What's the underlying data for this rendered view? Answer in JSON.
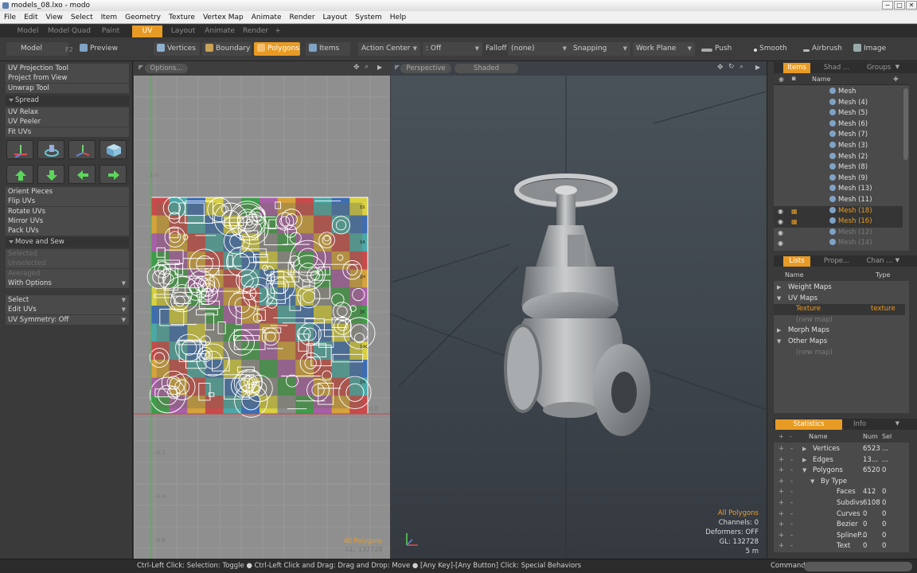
{
  "window": {
    "title": "models_08.lxo - modo",
    "min": "−",
    "max": "□",
    "close": "✕"
  },
  "menu": [
    "File",
    "Edit",
    "View",
    "Select",
    "Item",
    "Geometry",
    "Texture",
    "Vertex Map",
    "Animate",
    "Render",
    "Layout",
    "System",
    "Help"
  ],
  "layout_tabs": [
    "Model",
    "Model Quad",
    "Paint",
    "UV",
    "Layout",
    "Animate",
    "Render",
    "+"
  ],
  "active_layout_tab": "UV",
  "toolbar": {
    "model": "Model",
    "f2": "F2",
    "preview": "Preview",
    "vertices": "Vertices",
    "boundary": "Boundary",
    "polygons": "Polygons",
    "items": "Items",
    "action_center": "Action Center",
    "action_center_value": ": Off",
    "falloff": "Falloff",
    "falloff_value": "(none)",
    "snapping": "Snapping",
    "work_plane": "Work Plane",
    "push": "Push",
    "smooth": "Smooth",
    "airbrush": "Airbrush",
    "image": "Image"
  },
  "left_tools": {
    "group1": [
      "UV Projection Tool",
      "Project from View",
      "Unwrap Tool"
    ],
    "spread_header": "Spread",
    "group2": [
      "UV Relax",
      "UV Peeler",
      "Fit UVs"
    ],
    "group3": [
      "Orient Pieces",
      "Flip UVs",
      "Rotate UVs",
      "Mirror UVs",
      "Pack UVs"
    ],
    "move_sew_header": "Move and Sew",
    "group4_dim": [
      "Selected",
      "Unselected",
      "Averaged"
    ],
    "with_options": "With Options",
    "dropdowns": [
      "Select",
      "Edit UVs",
      "UV Symmetry: Off"
    ]
  },
  "uv_view": {
    "options": "Options...",
    "tick_top": "1.0",
    "tick_zero": "0.0",
    "ticks_left": [
      "-0.2",
      "-0.4",
      "-0.6"
    ],
    "footer_label": "All Polygons",
    "footer_gl": "GL: 132728",
    "checker_tags": [
      "1S",
      "14",
      "1H",
      "1K",
      "14K",
      "1N"
    ]
  },
  "viewport": {
    "camera": "Perspective",
    "shading": "Shaded",
    "info_title": "All Polygons",
    "channels": "Channels: 0",
    "deformers": "Deformers: OFF",
    "gl": "GL: 132728",
    "scale": "5 m"
  },
  "items_panel": {
    "tabs": [
      "Items",
      "Shad ...",
      "Groups"
    ],
    "col_name": "Name",
    "items": [
      {
        "name": "Mesh",
        "state": "normal"
      },
      {
        "name": "Mesh (4)",
        "state": "normal"
      },
      {
        "name": "Mesh (5)",
        "state": "normal"
      },
      {
        "name": "Mesh (6)",
        "state": "normal"
      },
      {
        "name": "Mesh (7)",
        "state": "normal"
      },
      {
        "name": "Mesh (3)",
        "state": "normal"
      },
      {
        "name": "Mesh (2)",
        "state": "normal"
      },
      {
        "name": "Mesh (8)",
        "state": "normal"
      },
      {
        "name": "Mesh (9)",
        "state": "normal"
      },
      {
        "name": "Mesh (13)",
        "state": "normal"
      },
      {
        "name": "Mesh (11)",
        "state": "normal"
      },
      {
        "name": "Mesh (18)",
        "state": "selected"
      },
      {
        "name": "Mesh (16)",
        "state": "selected"
      },
      {
        "name": "Mesh (12)",
        "state": "dim"
      },
      {
        "name": "Mesh (14)",
        "state": "dim"
      }
    ]
  },
  "lists_panel": {
    "tabs": [
      "Lists",
      "Prope...",
      "Chan ..."
    ],
    "col_name": "Name",
    "col_type": "Type",
    "rows": [
      {
        "label": "Weight Maps",
        "type": "",
        "kind": "group-closed"
      },
      {
        "label": "UV Maps",
        "type": "",
        "kind": "group-open"
      },
      {
        "label": "Texture",
        "type": "texture",
        "kind": "selected"
      },
      {
        "label": "(new map)",
        "type": "",
        "kind": "dim"
      },
      {
        "label": "Morph Maps",
        "type": "",
        "kind": "group-closed"
      },
      {
        "label": "Other Maps",
        "type": "",
        "kind": "group-open"
      },
      {
        "label": "(new map)",
        "type": "",
        "kind": "dim"
      }
    ]
  },
  "stats_panel": {
    "tabs": [
      "Statistics",
      "Info"
    ],
    "headers": [
      "Name",
      "Num",
      "Sel"
    ],
    "rows": [
      {
        "name": "Vertices",
        "num": "6523",
        "sel": "...",
        "indent": 1,
        "arrow": "▶"
      },
      {
        "name": "Edges",
        "num": "13...",
        "sel": "...",
        "indent": 1,
        "arrow": "▶"
      },
      {
        "name": "Polygons",
        "num": "6520",
        "sel": "0",
        "indent": 1,
        "arrow": "▼"
      },
      {
        "name": "By Type",
        "num": "",
        "sel": "",
        "indent": 2,
        "arrow": "▼"
      },
      {
        "name": "Faces",
        "num": "412",
        "sel": "0",
        "indent": 3,
        "arrow": ""
      },
      {
        "name": "Subdivs",
        "num": "6108",
        "sel": "0",
        "indent": 3,
        "arrow": ""
      },
      {
        "name": "Curves",
        "num": "0",
        "sel": "0",
        "indent": 3,
        "arrow": ""
      },
      {
        "name": "Bezier",
        "num": "0",
        "sel": "0",
        "indent": 3,
        "arrow": ""
      },
      {
        "name": "SplineP...",
        "num": "0",
        "sel": "0",
        "indent": 3,
        "arrow": ""
      },
      {
        "name": "Text",
        "num": "0",
        "sel": "0",
        "indent": 3,
        "arrow": ""
      }
    ]
  },
  "statusbar": {
    "hint": "Ctrl-Left Click: Selection: Toggle ● Ctrl-Left Click and Drag: Drag and Drop: Move ● [Any Key]-[Any Button] Click: Special Behaviors",
    "command": "Command"
  },
  "colors": {
    "accent": "#e89b24",
    "panel": "#3a3a3a",
    "uv_bg": "#8f8f8f"
  }
}
